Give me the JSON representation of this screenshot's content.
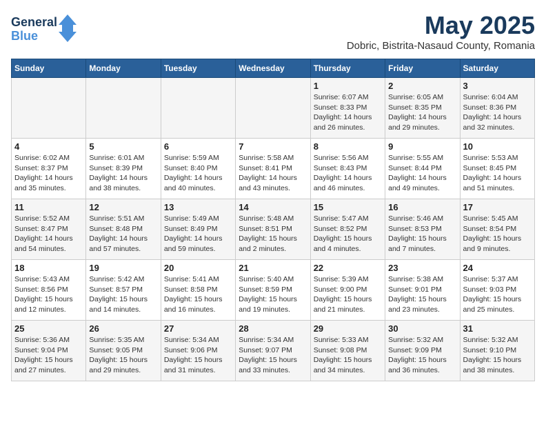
{
  "header": {
    "logo_line1": "General",
    "logo_line2": "Blue",
    "month": "May 2025",
    "location": "Dobric, Bistrita-Nasaud County, Romania"
  },
  "weekdays": [
    "Sunday",
    "Monday",
    "Tuesday",
    "Wednesday",
    "Thursday",
    "Friday",
    "Saturday"
  ],
  "weeks": [
    [
      {
        "day": "",
        "info": ""
      },
      {
        "day": "",
        "info": ""
      },
      {
        "day": "",
        "info": ""
      },
      {
        "day": "",
        "info": ""
      },
      {
        "day": "1",
        "info": "Sunrise: 6:07 AM\nSunset: 8:33 PM\nDaylight: 14 hours\nand 26 minutes."
      },
      {
        "day": "2",
        "info": "Sunrise: 6:05 AM\nSunset: 8:35 PM\nDaylight: 14 hours\nand 29 minutes."
      },
      {
        "day": "3",
        "info": "Sunrise: 6:04 AM\nSunset: 8:36 PM\nDaylight: 14 hours\nand 32 minutes."
      }
    ],
    [
      {
        "day": "4",
        "info": "Sunrise: 6:02 AM\nSunset: 8:37 PM\nDaylight: 14 hours\nand 35 minutes."
      },
      {
        "day": "5",
        "info": "Sunrise: 6:01 AM\nSunset: 8:39 PM\nDaylight: 14 hours\nand 38 minutes."
      },
      {
        "day": "6",
        "info": "Sunrise: 5:59 AM\nSunset: 8:40 PM\nDaylight: 14 hours\nand 40 minutes."
      },
      {
        "day": "7",
        "info": "Sunrise: 5:58 AM\nSunset: 8:41 PM\nDaylight: 14 hours\nand 43 minutes."
      },
      {
        "day": "8",
        "info": "Sunrise: 5:56 AM\nSunset: 8:43 PM\nDaylight: 14 hours\nand 46 minutes."
      },
      {
        "day": "9",
        "info": "Sunrise: 5:55 AM\nSunset: 8:44 PM\nDaylight: 14 hours\nand 49 minutes."
      },
      {
        "day": "10",
        "info": "Sunrise: 5:53 AM\nSunset: 8:45 PM\nDaylight: 14 hours\nand 51 minutes."
      }
    ],
    [
      {
        "day": "11",
        "info": "Sunrise: 5:52 AM\nSunset: 8:47 PM\nDaylight: 14 hours\nand 54 minutes."
      },
      {
        "day": "12",
        "info": "Sunrise: 5:51 AM\nSunset: 8:48 PM\nDaylight: 14 hours\nand 57 minutes."
      },
      {
        "day": "13",
        "info": "Sunrise: 5:49 AM\nSunset: 8:49 PM\nDaylight: 14 hours\nand 59 minutes."
      },
      {
        "day": "14",
        "info": "Sunrise: 5:48 AM\nSunset: 8:51 PM\nDaylight: 15 hours\nand 2 minutes."
      },
      {
        "day": "15",
        "info": "Sunrise: 5:47 AM\nSunset: 8:52 PM\nDaylight: 15 hours\nand 4 minutes."
      },
      {
        "day": "16",
        "info": "Sunrise: 5:46 AM\nSunset: 8:53 PM\nDaylight: 15 hours\nand 7 minutes."
      },
      {
        "day": "17",
        "info": "Sunrise: 5:45 AM\nSunset: 8:54 PM\nDaylight: 15 hours\nand 9 minutes."
      }
    ],
    [
      {
        "day": "18",
        "info": "Sunrise: 5:43 AM\nSunset: 8:56 PM\nDaylight: 15 hours\nand 12 minutes."
      },
      {
        "day": "19",
        "info": "Sunrise: 5:42 AM\nSunset: 8:57 PM\nDaylight: 15 hours\nand 14 minutes."
      },
      {
        "day": "20",
        "info": "Sunrise: 5:41 AM\nSunset: 8:58 PM\nDaylight: 15 hours\nand 16 minutes."
      },
      {
        "day": "21",
        "info": "Sunrise: 5:40 AM\nSunset: 8:59 PM\nDaylight: 15 hours\nand 19 minutes."
      },
      {
        "day": "22",
        "info": "Sunrise: 5:39 AM\nSunset: 9:00 PM\nDaylight: 15 hours\nand 21 minutes."
      },
      {
        "day": "23",
        "info": "Sunrise: 5:38 AM\nSunset: 9:01 PM\nDaylight: 15 hours\nand 23 minutes."
      },
      {
        "day": "24",
        "info": "Sunrise: 5:37 AM\nSunset: 9:03 PM\nDaylight: 15 hours\nand 25 minutes."
      }
    ],
    [
      {
        "day": "25",
        "info": "Sunrise: 5:36 AM\nSunset: 9:04 PM\nDaylight: 15 hours\nand 27 minutes."
      },
      {
        "day": "26",
        "info": "Sunrise: 5:35 AM\nSunset: 9:05 PM\nDaylight: 15 hours\nand 29 minutes."
      },
      {
        "day": "27",
        "info": "Sunrise: 5:34 AM\nSunset: 9:06 PM\nDaylight: 15 hours\nand 31 minutes."
      },
      {
        "day": "28",
        "info": "Sunrise: 5:34 AM\nSunset: 9:07 PM\nDaylight: 15 hours\nand 33 minutes."
      },
      {
        "day": "29",
        "info": "Sunrise: 5:33 AM\nSunset: 9:08 PM\nDaylight: 15 hours\nand 34 minutes."
      },
      {
        "day": "30",
        "info": "Sunrise: 5:32 AM\nSunset: 9:09 PM\nDaylight: 15 hours\nand 36 minutes."
      },
      {
        "day": "31",
        "info": "Sunrise: 5:32 AM\nSunset: 9:10 PM\nDaylight: 15 hours\nand 38 minutes."
      }
    ]
  ]
}
